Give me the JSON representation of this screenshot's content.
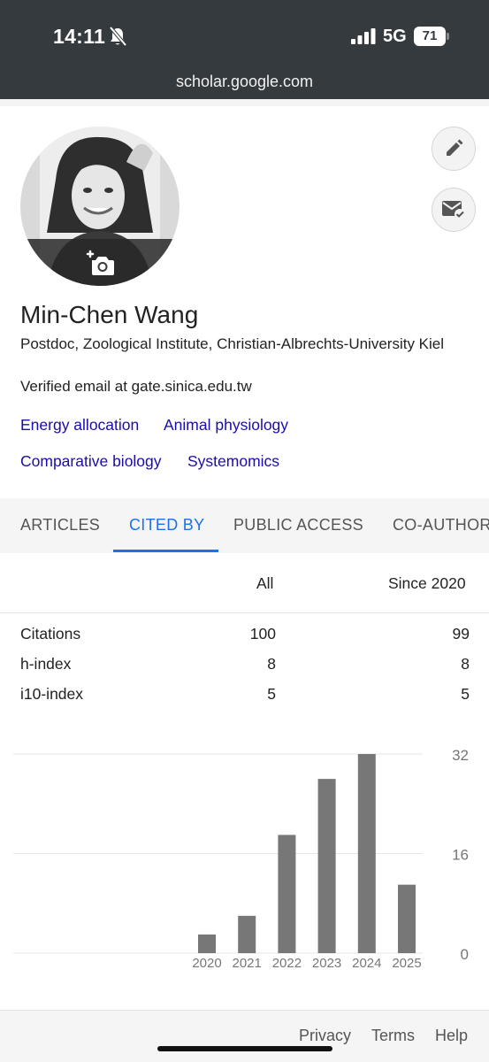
{
  "status_bar": {
    "time": "14:11",
    "network": "5G",
    "battery": "71"
  },
  "browser": {
    "url": "scholar.google.com"
  },
  "profile": {
    "name": "Min-Chen Wang",
    "affiliation": "Postdoc, Zoological Institute, Christian-Albrechts-University Kiel",
    "email": "Verified email at gate.sinica.edu.tw",
    "interests": [
      "Energy allocation",
      "Animal physiology",
      "Comparative biology",
      "Systemomics"
    ]
  },
  "tabs": [
    {
      "label": "ARTICLES",
      "active": false
    },
    {
      "label": "CITED BY",
      "active": true
    },
    {
      "label": "PUBLIC ACCESS",
      "active": false
    },
    {
      "label": "CO-AUTHOR",
      "active": false
    }
  ],
  "citations_table": {
    "headers": [
      "All",
      "Since 2020"
    ],
    "rows": [
      {
        "label": "Citations",
        "all": "100",
        "since": "99"
      },
      {
        "label": "h-index",
        "all": "8",
        "since": "8"
      },
      {
        "label": "i10-index",
        "all": "5",
        "since": "5"
      }
    ]
  },
  "chart_data": {
    "type": "bar",
    "categories": [
      "2020",
      "2021",
      "2022",
      "2023",
      "2024",
      "2025"
    ],
    "values": [
      3,
      6,
      19,
      28,
      32,
      11
    ],
    "ylim": [
      0,
      32
    ],
    "yticks": [
      "0",
      "16",
      "32"
    ],
    "grid": true,
    "bar_color": "#777777"
  },
  "footer": {
    "privacy": "Privacy",
    "terms": "Terms",
    "help": "Help"
  },
  "colors": {
    "link": "#1a0dab",
    "tab_active": "#1a73e8",
    "topbar": "#353a3e"
  }
}
